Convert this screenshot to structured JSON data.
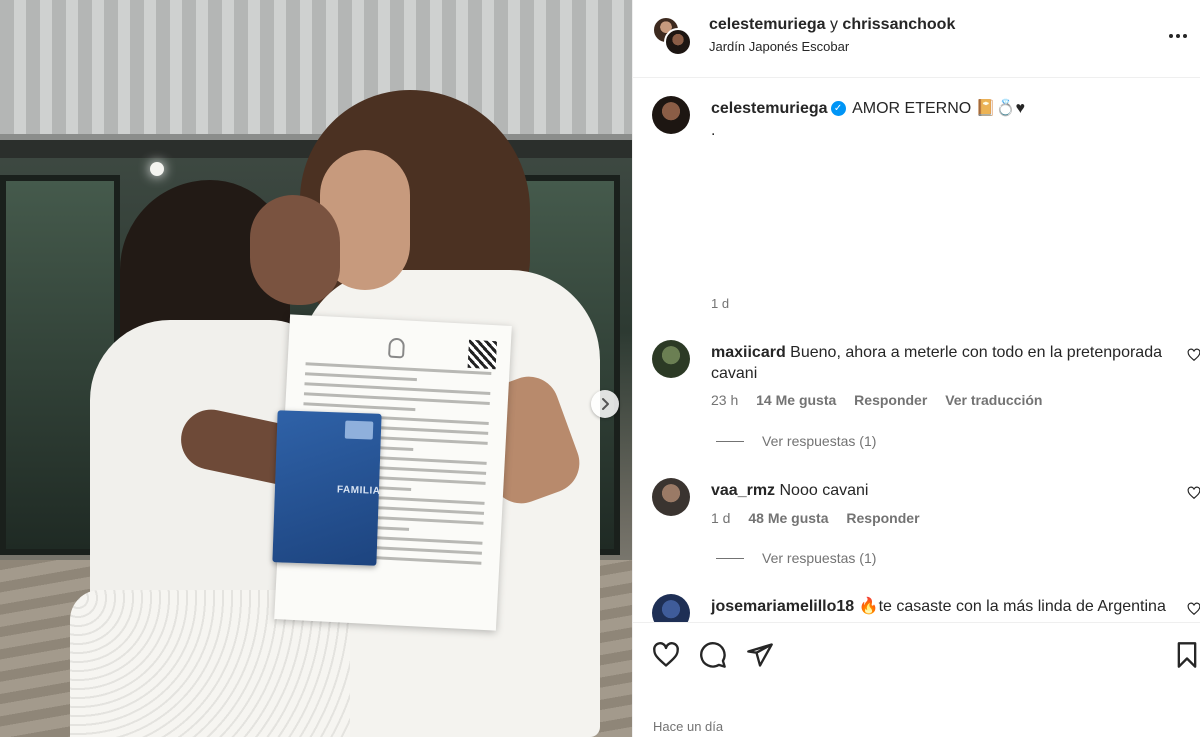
{
  "post": {
    "header": {
      "author": "celestemuriega",
      "conjunction": "y",
      "collaborator": "chrissanchook",
      "location": "Jardín Japonés Escobar"
    },
    "caption": {
      "username": "celestemuriega",
      "verified": true,
      "text": "AMOR ETERNO 📔💍♥",
      "extra_line": ".",
      "time": "1 d"
    },
    "photo": {
      "booklet_label": "FAMILIA"
    },
    "comments": [
      {
        "username": "maxiicard",
        "text": "Bueno, ahora a meterle con todo en la pretenporada cavani",
        "time": "23 h",
        "likes": "14 Me gusta",
        "reply": "Responder",
        "translate": "Ver traducción",
        "view_replies": "Ver respuestas (1)"
      },
      {
        "username": "vaa_rmz",
        "text": "Nooo cavani",
        "time": "1 d",
        "likes": "48 Me gusta",
        "reply": "Responder",
        "view_replies": "Ver respuestas (1)"
      },
      {
        "username": "josemariamelillo18",
        "text": "🔥te casaste con la más linda de Argentina"
      }
    ],
    "posted_time": "Hace un día"
  },
  "icons": {
    "like": "heart-icon",
    "comment": "comment-icon",
    "share": "share-icon",
    "save": "bookmark-icon",
    "more": "more-options-icon",
    "next": "chevron-right-icon",
    "verified": "verified-badge-icon"
  },
  "colors": {
    "verified": "#0095f6",
    "secondary_text": "#737373",
    "primary_text": "#262626",
    "divider": "#efefef"
  }
}
